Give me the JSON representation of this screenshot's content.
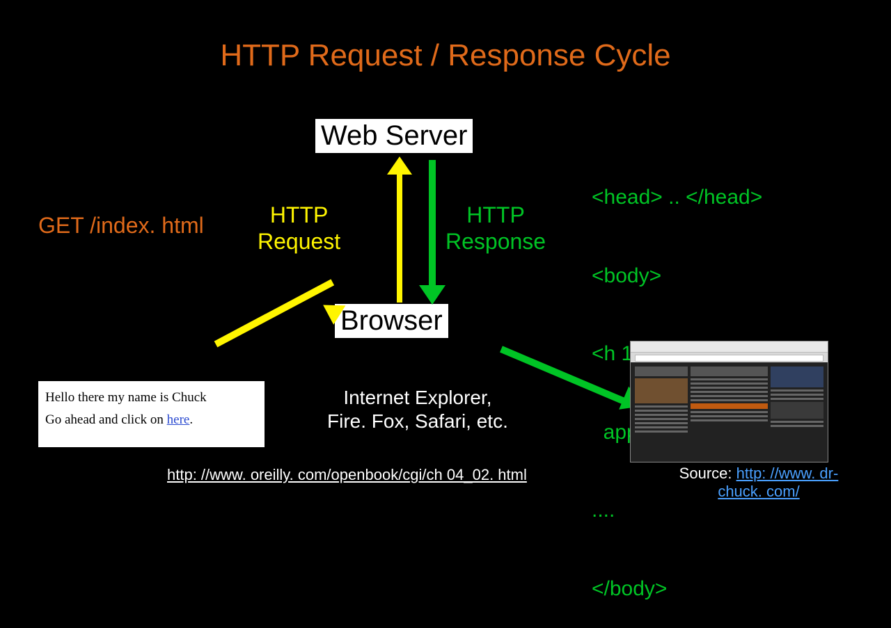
{
  "title": "HTTP Request / Response Cycle",
  "nodes": {
    "web_server": "Web Server",
    "browser": "Browser"
  },
  "labels": {
    "get_request": "GET /index. html",
    "http_request_line1": "HTTP",
    "http_request_line2": "Request",
    "http_response_line1": "HTTP",
    "http_response_line2": "Response",
    "browsers_line1": "Internet Explorer,",
    "browsers_line2": "Fire. Fox, Safari, etc."
  },
  "response_payload": [
    "<head> .. </head>",
    "<body>",
    "<h 1>Welcome to my",
    "  application</h 1>",
    "....",
    "</body>"
  ],
  "snippet": {
    "line1": "Hello there my name is Chuck",
    "line2_prefix": "Go ahead and click on ",
    "line2_link": "here",
    "line2_suffix": "."
  },
  "footer_link": "http: //www. oreilly. com/openbook/cgi/ch 04_02. html",
  "source": {
    "prefix": "Source: ",
    "link_line1": "http: //www. dr-",
    "link_line2": "chuck. com/"
  }
}
